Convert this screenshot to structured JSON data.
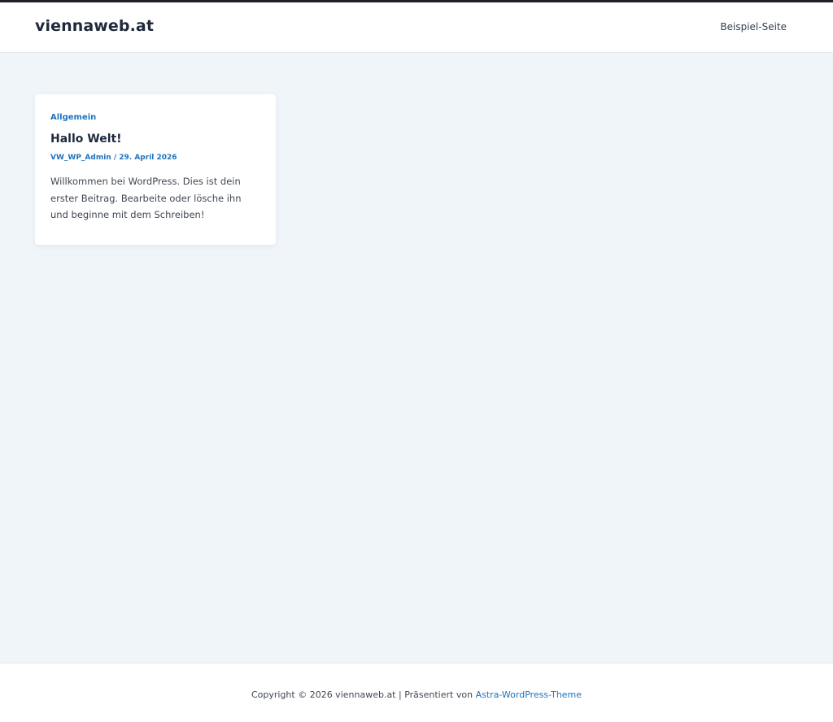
{
  "header": {
    "site_title": "viennaweb.at",
    "nav_item": "Beispiel-Seite"
  },
  "post": {
    "category": "Allgemein",
    "title": "Hallo Welt!",
    "author": "VW_WP_Admin",
    "separator": " / ",
    "date": "29. April 2026",
    "excerpt": "Willkommen bei WordPress. Dies ist dein erster Beitrag. Bearbeite oder lösche ihn und beginne mit dem Schreiben!"
  },
  "footer": {
    "copyright": "Copyright © 2026 viennaweb.at | Präsentiert von ",
    "theme_link": "Astra-WordPress-Theme"
  },
  "colors": {
    "accent": "#1e73be",
    "background": "#f0f5fa",
    "heading": "#1e293b"
  }
}
